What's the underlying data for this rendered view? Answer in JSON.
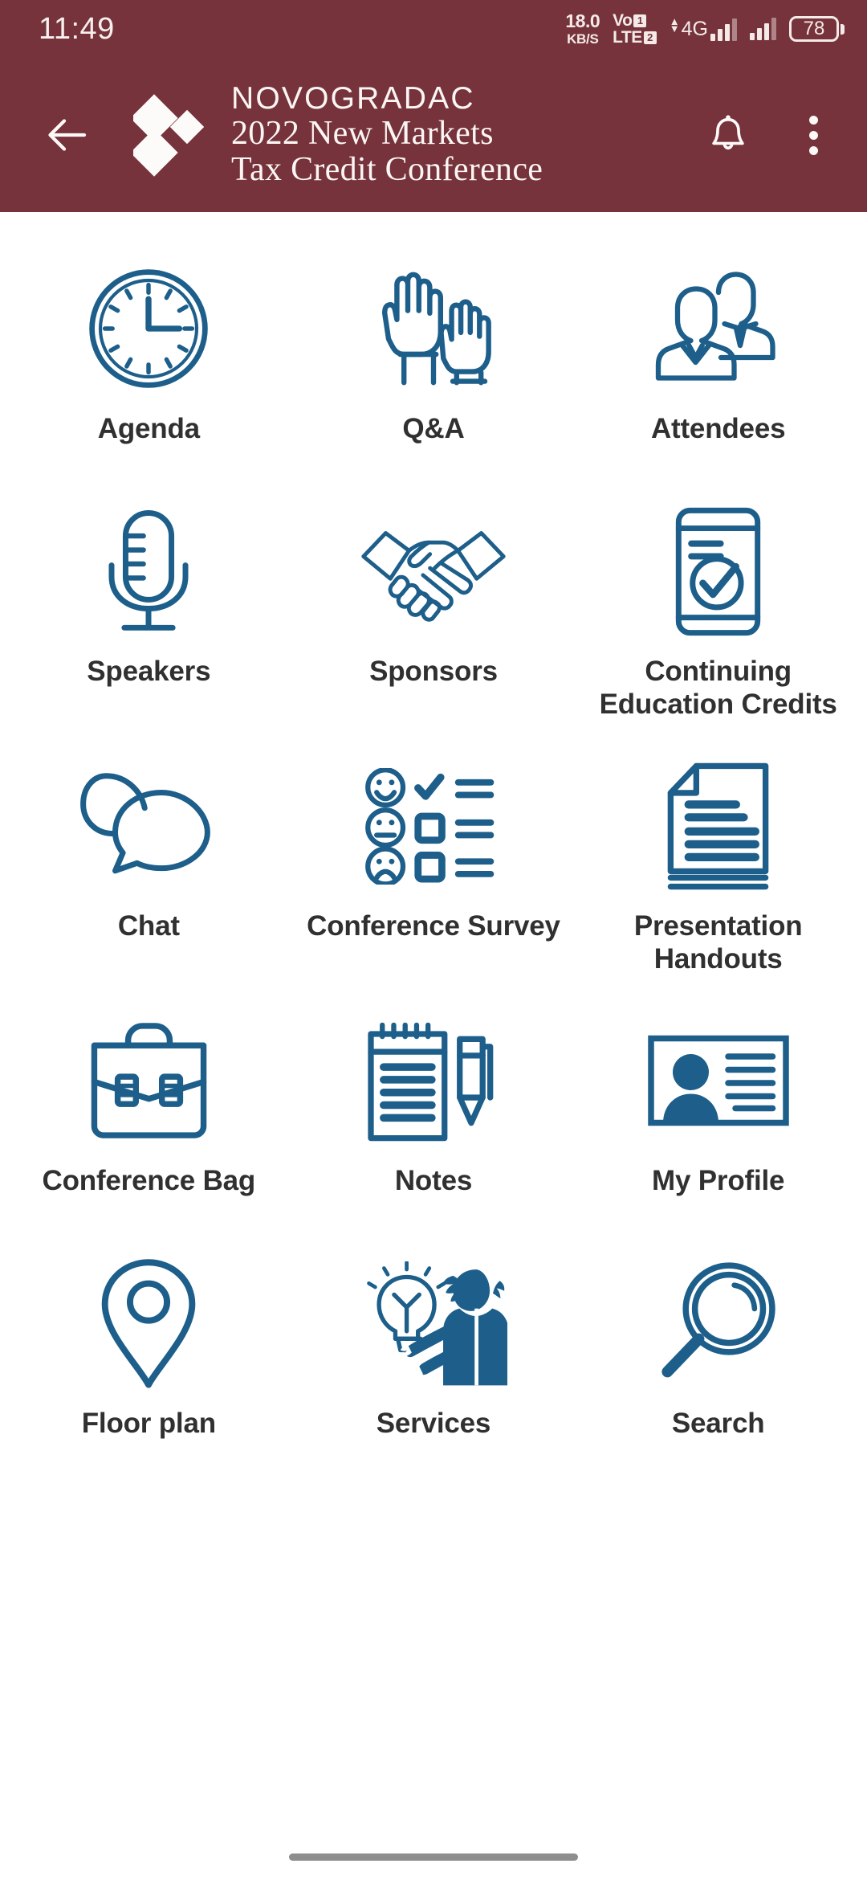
{
  "status_bar": {
    "clock": "11:49",
    "net_speed_value": "18.0",
    "net_speed_unit": "KB/S",
    "volte_top": "Vo",
    "volte_bottom": "LTE",
    "sim_badge_1": "1",
    "sim_badge_2": "2",
    "network_type": "4G",
    "battery_percent": "78"
  },
  "app_bar": {
    "back_icon": "back-arrow-icon",
    "logo_mark": "novogradac-diamonds-logo",
    "brand_line1": "NOVOGRADAC",
    "brand_line2": "2022 New Markets",
    "brand_line3": "Tax Credit Conference",
    "notification_icon": "bell-icon",
    "overflow_icon": "three-dot-menu-icon"
  },
  "theme": {
    "header_bg": "#76333b",
    "icon_blue": "#1d5f8a",
    "label_color": "#303030",
    "page_bg": "#ffffff"
  },
  "menu": {
    "items": [
      {
        "label": "Agenda",
        "icon": "clock-icon"
      },
      {
        "label": "Q&A",
        "icon": "raised-hands-icon"
      },
      {
        "label": "Attendees",
        "icon": "two-people-icon"
      },
      {
        "label": "Speakers",
        "icon": "microphone-icon"
      },
      {
        "label": "Sponsors",
        "icon": "handshake-icon"
      },
      {
        "label": "Continuing Education Credits",
        "icon": "phone-checkmark-icon"
      },
      {
        "label": "Chat",
        "icon": "speech-bubbles-icon"
      },
      {
        "label": "Conference Survey",
        "icon": "survey-smileys-icon"
      },
      {
        "label": "Presentation Handouts",
        "icon": "document-pages-icon"
      },
      {
        "label": "Conference Bag",
        "icon": "briefcase-icon"
      },
      {
        "label": "Notes",
        "icon": "notepad-pen-icon"
      },
      {
        "label": "My Profile",
        "icon": "id-card-icon"
      },
      {
        "label": "Floor plan",
        "icon": "map-pin-icon"
      },
      {
        "label": "Services",
        "icon": "presenter-lightbulb-icon"
      },
      {
        "label": "Search",
        "icon": "magnifier-icon"
      }
    ]
  },
  "nav_bar": {
    "gesture_handle": "home-gesture-pill"
  }
}
